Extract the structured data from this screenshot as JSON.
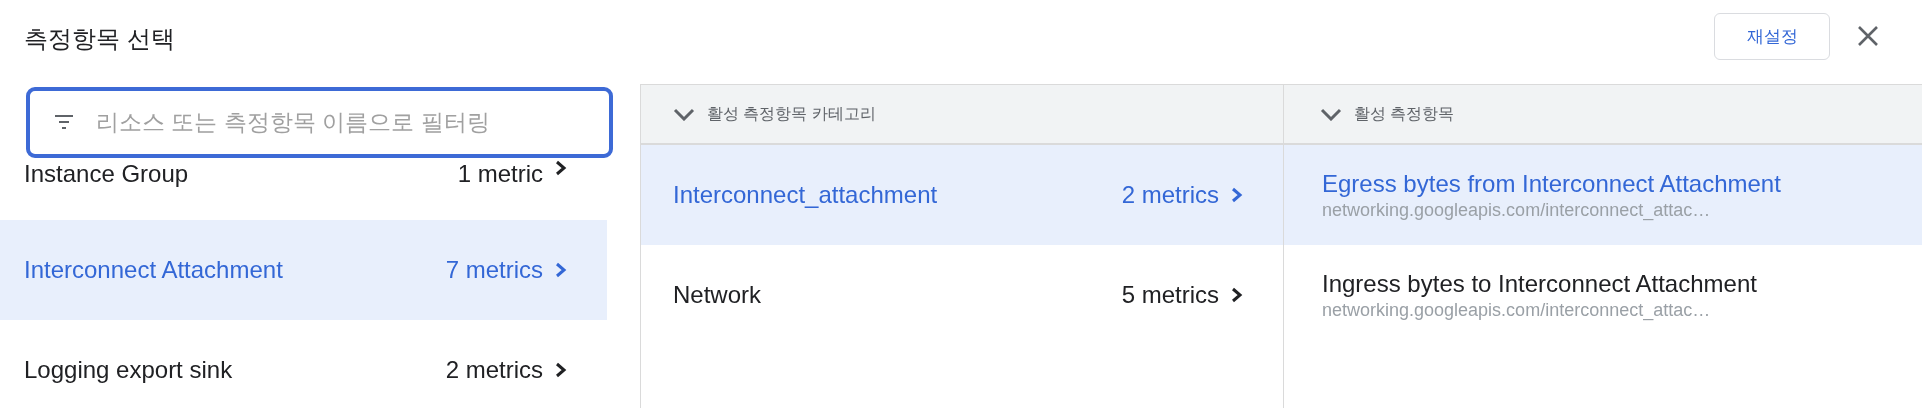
{
  "title": "측정항목 선택",
  "reset_button": "재설정",
  "search": {
    "placeholder": "리소스 또는 측정항목 이름으로 필터링"
  },
  "resources": [
    {
      "name": "Instance Group",
      "count": "1 metric",
      "selected": false
    },
    {
      "name": "Interconnect Attachment",
      "count": "7 metrics",
      "selected": true
    },
    {
      "name": "Logging export sink",
      "count": "2 metrics",
      "selected": false
    }
  ],
  "categories": {
    "header": "활성 측정항목 카테고리",
    "items": [
      {
        "name": "Interconnect_attachment",
        "count": "2 metrics",
        "selected": true
      },
      {
        "name": "Network",
        "count": "5 metrics",
        "selected": false
      }
    ]
  },
  "metrics": {
    "header": "활성 측정항목",
    "items": [
      {
        "name": "Egress bytes from Interconnect Attachment",
        "path": "networking.googleapis.com/interconnect_attac…",
        "selected": true
      },
      {
        "name": "Ingress bytes to Interconnect Attachment",
        "path": "networking.googleapis.com/interconnect_attac…",
        "selected": false
      }
    ]
  }
}
